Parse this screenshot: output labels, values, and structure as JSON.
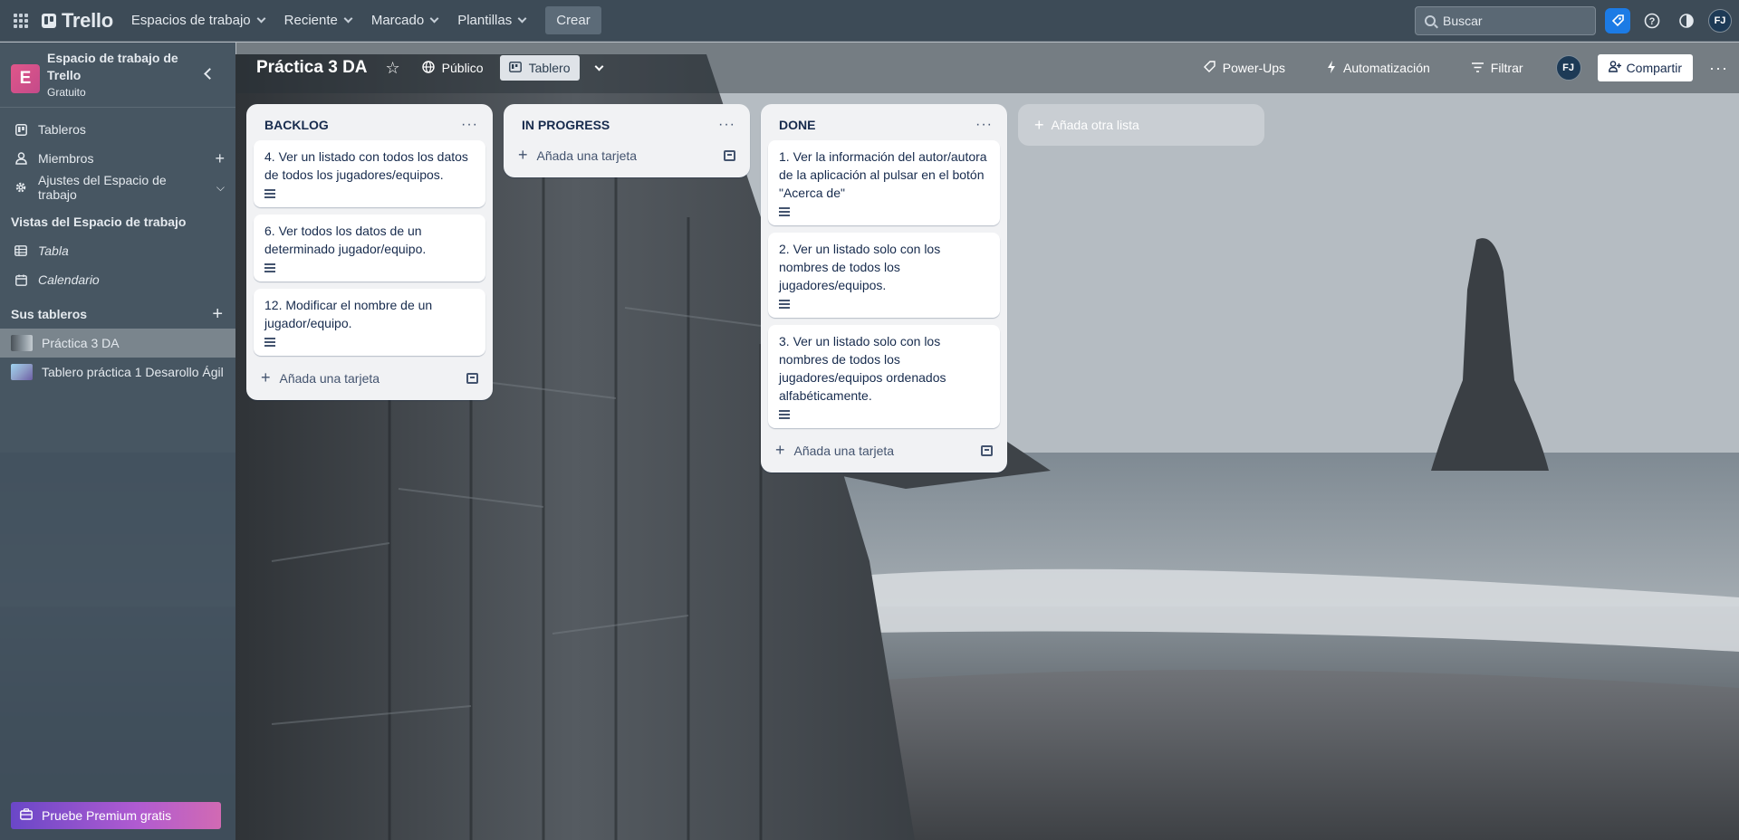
{
  "app": {
    "name": "Trello",
    "nav": [
      "Espacios de trabajo",
      "Reciente",
      "Marcado",
      "Plantillas"
    ],
    "create_label": "Crear",
    "search_placeholder": "Buscar",
    "user_initials": "FJ"
  },
  "sidebar": {
    "workspace_name": "Espacio de trabajo de Trello",
    "workspace_initial": "E",
    "workspace_plan": "Gratuito",
    "items": [
      {
        "label": "Tableros"
      },
      {
        "label": "Miembros"
      },
      {
        "label": "Ajustes del Espacio de trabajo"
      }
    ],
    "views_title": "Vistas del Espacio de trabajo",
    "views": [
      {
        "label": "Tabla"
      },
      {
        "label": "Calendario"
      }
    ],
    "boards_title": "Sus tableros",
    "boards": [
      {
        "label": "Práctica 3 DA",
        "active": true
      },
      {
        "label": "Tablero práctica 1 Desarollo Ágil",
        "active": false
      }
    ],
    "premium_label": "Pruebe Premium gratis"
  },
  "board": {
    "title": "Práctica 3 DA",
    "visibility": "Público",
    "view": "Tablero",
    "powerups": "Power-Ups",
    "automation": "Automatización",
    "filter": "Filtrar",
    "member_initials": "FJ",
    "share": "Compartir"
  },
  "lists": [
    {
      "title": "BACKLOG",
      "cards": [
        "4. Ver un listado con todos los datos de todos los jugadores/equipos.",
        "6. Ver todos los datos de un determinado jugador/equipo.",
        "12. Modificar el nombre de un jugador/equipo."
      ],
      "add_label": "Añada una tarjeta"
    },
    {
      "title": "IN PROGRESS",
      "cards": [],
      "add_label": "Añada una tarjeta"
    },
    {
      "title": "DONE",
      "cards": [
        "1. Ver la información del autor/autora de la aplicación al pulsar en el botón \"Acerca de\"",
        "2. Ver un listado solo con los nombres de todos los jugadores/equipos.",
        "3. Ver un listado solo con los nombres de todos los jugadores/equipos ordenados alfabéticamente."
      ],
      "add_label": "Añada una tarjeta"
    }
  ],
  "add_list_label": "Añada otra lista"
}
